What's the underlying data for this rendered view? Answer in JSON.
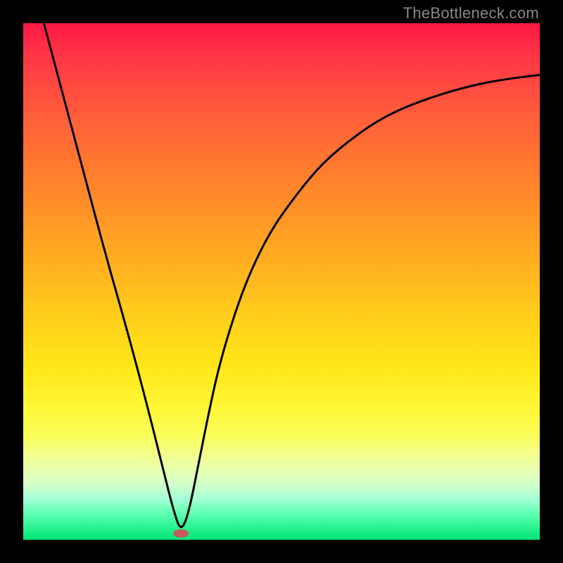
{
  "watermark_text": "TheBottleneck.com",
  "chart_data": {
    "type": "line",
    "title": "",
    "xlabel": "",
    "ylabel": "",
    "xlim": [
      0,
      100
    ],
    "ylim": [
      0,
      100
    ],
    "series": [
      {
        "name": "bottleneck-curve",
        "x": [
          4,
          8,
          12,
          16,
          20,
          24,
          27,
          29,
          30.5,
          32,
          34,
          36,
          38,
          41,
          44,
          48,
          53,
          58,
          64,
          70,
          77,
          85,
          92,
          100
        ],
        "y": [
          100,
          85,
          70,
          55,
          41,
          26,
          14,
          6,
          1.5,
          5,
          15,
          25,
          34,
          44,
          52,
          60,
          67,
          73,
          78,
          82,
          85,
          87.5,
          89,
          90
        ]
      }
    ],
    "marker": {
      "x": 30.5,
      "y": 1.2
    },
    "gradient_stops": [
      {
        "pos": 0,
        "color": "#ff1744"
      },
      {
        "pos": 50,
        "color": "#ffc107"
      },
      {
        "pos": 100,
        "color": "#00e676"
      }
    ]
  }
}
